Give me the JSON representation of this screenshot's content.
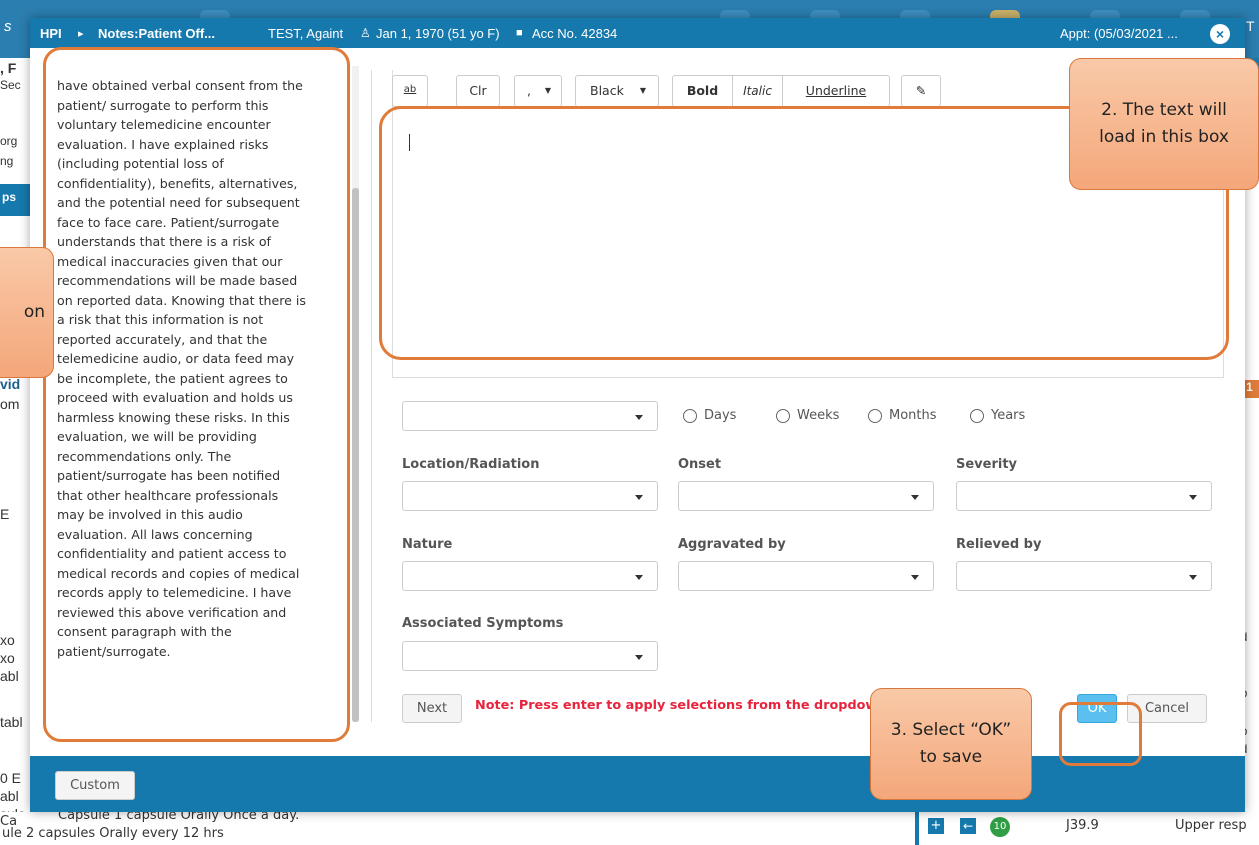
{
  "background": {
    "left_fragments": [
      "s",
      ", F",
      "Sec",
      "org",
      "ng",
      "ps",
      "vid",
      "om",
      "E",
      "xo",
      "xo",
      "abl",
      "tabl",
      "0 E",
      "abl",
      "sule",
      "Ca",
      "ule"
    ],
    "right_fragments": [
      "T",
      "er",
      "1",
      "p",
      "er",
      "or",
      "ed",
      "(p",
      "ab",
      "ab",
      "ed"
    ],
    "bottom_text": "Capsule 1 capsule Orally Once a day.",
    "bottom_text_2": "ule 2 capsules Orally every 12 hrs",
    "bottom_code": "J39.9",
    "bottom_desc": "Upper resp",
    "bottom_badge": "10"
  },
  "titlebar": {
    "section": "HPI",
    "breadcrumb_sep": "▸",
    "notes": "Notes:Patient Off...",
    "patient_name": "TEST, Againt",
    "dob": "Jan 1, 1970 (51 yo F)",
    "acc": "Acc No. 42834",
    "appt": "Appt: (05/03/2021 ..."
  },
  "consent_text": "have obtained verbal consent from the\npatient/ surrogate to perform this\nvoluntary telemedicine encounter\nevaluation. I have explained risks\n(including potential loss of\nconfidentiality), benefits, alternatives,\nand the potential need for subsequent\nface to face care. Patient/surrogate\nunderstands that there is a risk of\nmedical inaccuracies given that our\nrecommendations will be made based\non reported data. Knowing that there is\na risk that this information is not\nreported accurately, and that the\ntelemedicine audio, or data feed may\nbe incomplete, the patient agrees to\nproceed with evaluation and holds us\nharmless knowing these risks. In this\nevaluation, we will be providing\nrecommendations only. The\npatient/surrogate has been notified\nthat other healthcare professionals\nmay be involved in this audio\nevaluation. All laws concerning\nconfidentiality and patient access to\nmedical records and copies of medical\nrecords apply to telemedicine. I have\nreviewed this above verification and\nconsent paragraph with the\npatient/surrogate.",
  "toolbar": {
    "spell_label": "ab",
    "clr_label": "Clr",
    "punct_label": ",",
    "color_label": "Black",
    "bold_label": "Bold",
    "italic_label": "Italic",
    "underline_label": "Underline"
  },
  "duration": {
    "options": [
      "Days",
      "Weeks",
      "Months",
      "Years"
    ]
  },
  "fields": {
    "location_label": "Location/Radiation",
    "onset_label": "Onset",
    "severity_label": "Severity",
    "nature_label": "Nature",
    "aggravated_label": "Aggravated by",
    "relieved_label": "Relieved by",
    "associated_label": "Associated Symptoms"
  },
  "buttons": {
    "next": "Next",
    "ok": "OK",
    "cancel": "Cancel",
    "custom": "Custom"
  },
  "note": "Note: Press enter to apply selections from the dropdown",
  "callouts": {
    "left": "on",
    "text_box": "2. The text will load in this box",
    "ok_hint": "3. Select “OK” to save"
  },
  "colors": {
    "header_blue": "#1679ad",
    "annotation_orange": "#e07b39",
    "note_red": "#e8233c"
  }
}
